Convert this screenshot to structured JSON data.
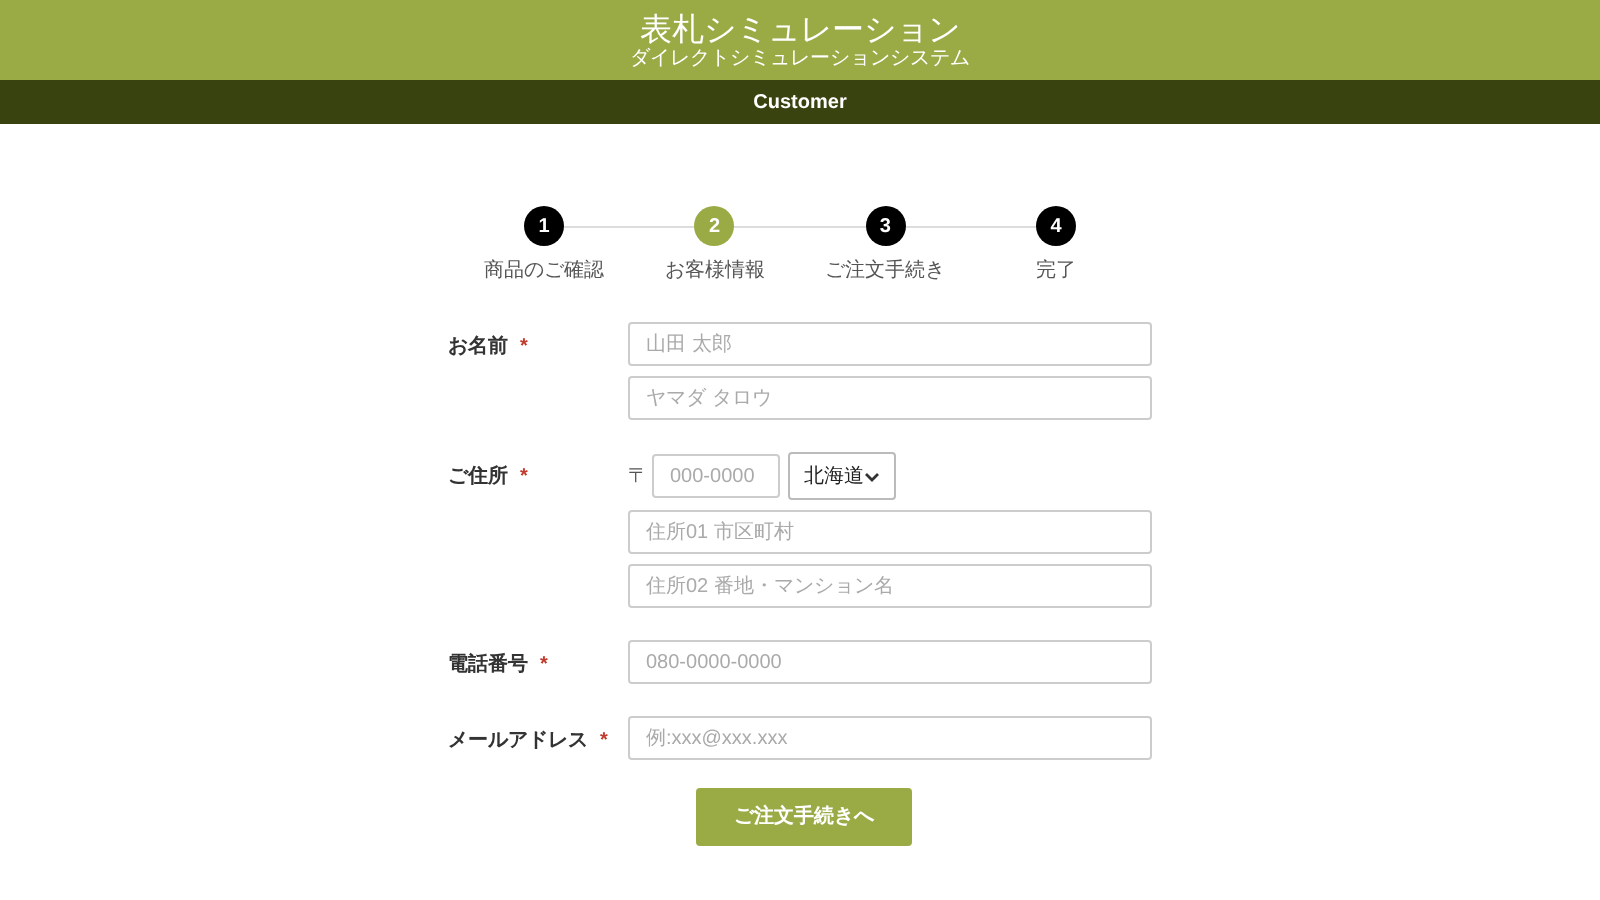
{
  "header": {
    "title": "表札シミュレーション",
    "subtitle": "ダイレクトシミュレーションシステム"
  },
  "nav": {
    "label": "Customer"
  },
  "steps": [
    {
      "number": "1",
      "label": "商品のご確認",
      "selected": false
    },
    {
      "number": "2",
      "label": "お客様情報",
      "selected": true
    },
    {
      "number": "3",
      "label": "ご注文手続き",
      "selected": false
    },
    {
      "number": "4",
      "label": "完了",
      "selected": false
    }
  ],
  "form": [
    {
      "label": "お名前",
      "required": "*",
      "fields": [
        {
          "kind": "text",
          "placeholder": "山田 太郎"
        },
        {
          "kind": "text",
          "placeholder": "ヤマダ タロウ"
        }
      ]
    },
    {
      "label": "ご住所",
      "required": "*",
      "fields": [
        {
          "kind": "postal",
          "prefix": "〒",
          "placeholder": "000-0000",
          "select_value": "北海道"
        },
        {
          "kind": "text",
          "placeholder": "住所01 市区町村"
        },
        {
          "kind": "text",
          "placeholder": "住所02 番地・マンション名"
        }
      ]
    },
    {
      "label": "電話番号",
      "required": "*",
      "fields": [
        {
          "kind": "text",
          "placeholder": "080-0000-0000"
        }
      ]
    },
    {
      "label": "メールアドレス",
      "required": "*",
      "fields": [
        {
          "kind": "text",
          "placeholder": "例:xxx@xxx.xxx"
        }
      ]
    }
  ],
  "submit": "ご注文手続きへ"
}
